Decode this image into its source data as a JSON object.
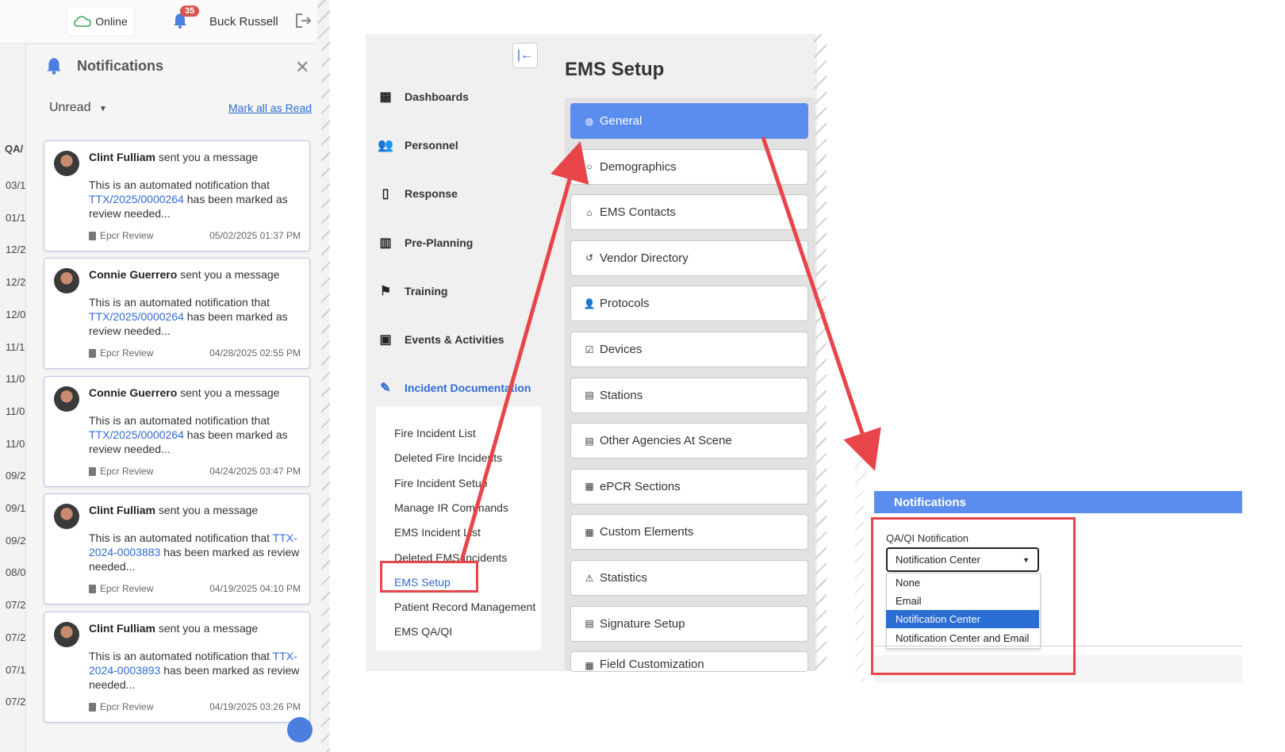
{
  "header": {
    "status": "Online",
    "notification_count": "35",
    "user_name": "Buck Russell"
  },
  "background_table": {
    "header": "QA/",
    "rows": [
      "03/1",
      "01/1",
      "12/2",
      "12/2",
      "12/0",
      "11/1",
      "11/0",
      "11/0",
      "11/0",
      "09/2",
      "09/1",
      "09/2",
      "08/0",
      "07/2",
      "07/2",
      "07/1",
      "07/2"
    ]
  },
  "notifications": {
    "title": "Notifications",
    "filter": "Unread",
    "mark_all": "Mark all as Read",
    "items": [
      {
        "sender": "Clint Fulliam",
        "action": "sent you a message",
        "pre": "This is an automated notification that ",
        "link": "TTX/2025/0000264",
        "post": " has been marked as review needed...",
        "source": "Epcr Review",
        "date": "05/02/2025 01:37 PM"
      },
      {
        "sender": "Connie Guerrero",
        "action": "sent you a message",
        "pre": "This is an automated notification that ",
        "link": "TTX/2025/0000264",
        "post": " has been marked as review needed...",
        "source": "Epcr Review",
        "date": "04/28/2025 02:55 PM"
      },
      {
        "sender": "Connie Guerrero",
        "action": "sent you a message",
        "pre": "This is an automated notification that ",
        "link": "TTX/2025/0000264",
        "post": " has been marked as review needed...",
        "source": "Epcr Review",
        "date": "04/24/2025 03:47 PM"
      },
      {
        "sender": "Clint Fulliam",
        "action": "sent you a message",
        "pre": "This is an automated notification that ",
        "link": "TTX-2024-0003883",
        "post": " has been marked as review needed...",
        "source": "Epcr Review",
        "date": "04/19/2025 04:10 PM"
      },
      {
        "sender": "Clint Fulliam",
        "action": "sent you a message",
        "pre": "This is an automated notification that ",
        "link": "TTX-2024-0003893",
        "post": " has been marked as review needed...",
        "source": "Epcr Review",
        "date": "04/19/2025 03:26 PM"
      }
    ]
  },
  "nav": {
    "items": [
      {
        "label": "Dashboards",
        "icon": "dashboard-icon"
      },
      {
        "label": "Personnel",
        "icon": "people-icon"
      },
      {
        "label": "Response",
        "icon": "response-icon"
      },
      {
        "label": "Pre-Planning",
        "icon": "map-icon"
      },
      {
        "label": "Training",
        "icon": "training-icon"
      },
      {
        "label": "Events & Activities",
        "icon": "calendar-icon"
      },
      {
        "label": "Incident Documentation",
        "icon": "document-icon"
      }
    ],
    "sub_items": [
      "Fire Incident List",
      "Deleted Fire Incidents",
      "Fire Incident Setup",
      "Manage IR Commands",
      "EMS Incident List",
      "Deleted EMS Incidents",
      "EMS Setup",
      "Patient Record Management",
      "EMS QA/QI"
    ]
  },
  "ems_setup": {
    "title": "EMS Setup",
    "items": [
      {
        "label": "General",
        "icon": "globe-icon"
      },
      {
        "label": "Demographics",
        "icon": "circle-icon"
      },
      {
        "label": "EMS Contacts",
        "icon": "home-icon"
      },
      {
        "label": "Vendor Directory",
        "icon": "history-icon"
      },
      {
        "label": "Protocols",
        "icon": "user-icon"
      },
      {
        "label": "Devices",
        "icon": "checkbox-icon"
      },
      {
        "label": "Stations",
        "icon": "building-icon"
      },
      {
        "label": "Other Agencies At Scene",
        "icon": "file-icon"
      },
      {
        "label": "ePCR Sections",
        "icon": "grid-icon"
      },
      {
        "label": "Custom Elements",
        "icon": "grid-icon"
      },
      {
        "label": "Statistics",
        "icon": "warning-icon"
      },
      {
        "label": "Signature Setup",
        "icon": "file-icon"
      },
      {
        "label": "Field Customization",
        "icon": "grid-icon"
      }
    ]
  },
  "notification_settings": {
    "header": "Notifications",
    "field_label": "QA/QI Notification",
    "selected": "Notification Center",
    "options": [
      "None",
      "Email",
      "Notification Center",
      "Notification Center and Email"
    ]
  },
  "colors": {
    "accent": "#5b8def",
    "link": "#2f6bd6",
    "annotation": "#e8454a",
    "badge": "#d9534f"
  }
}
